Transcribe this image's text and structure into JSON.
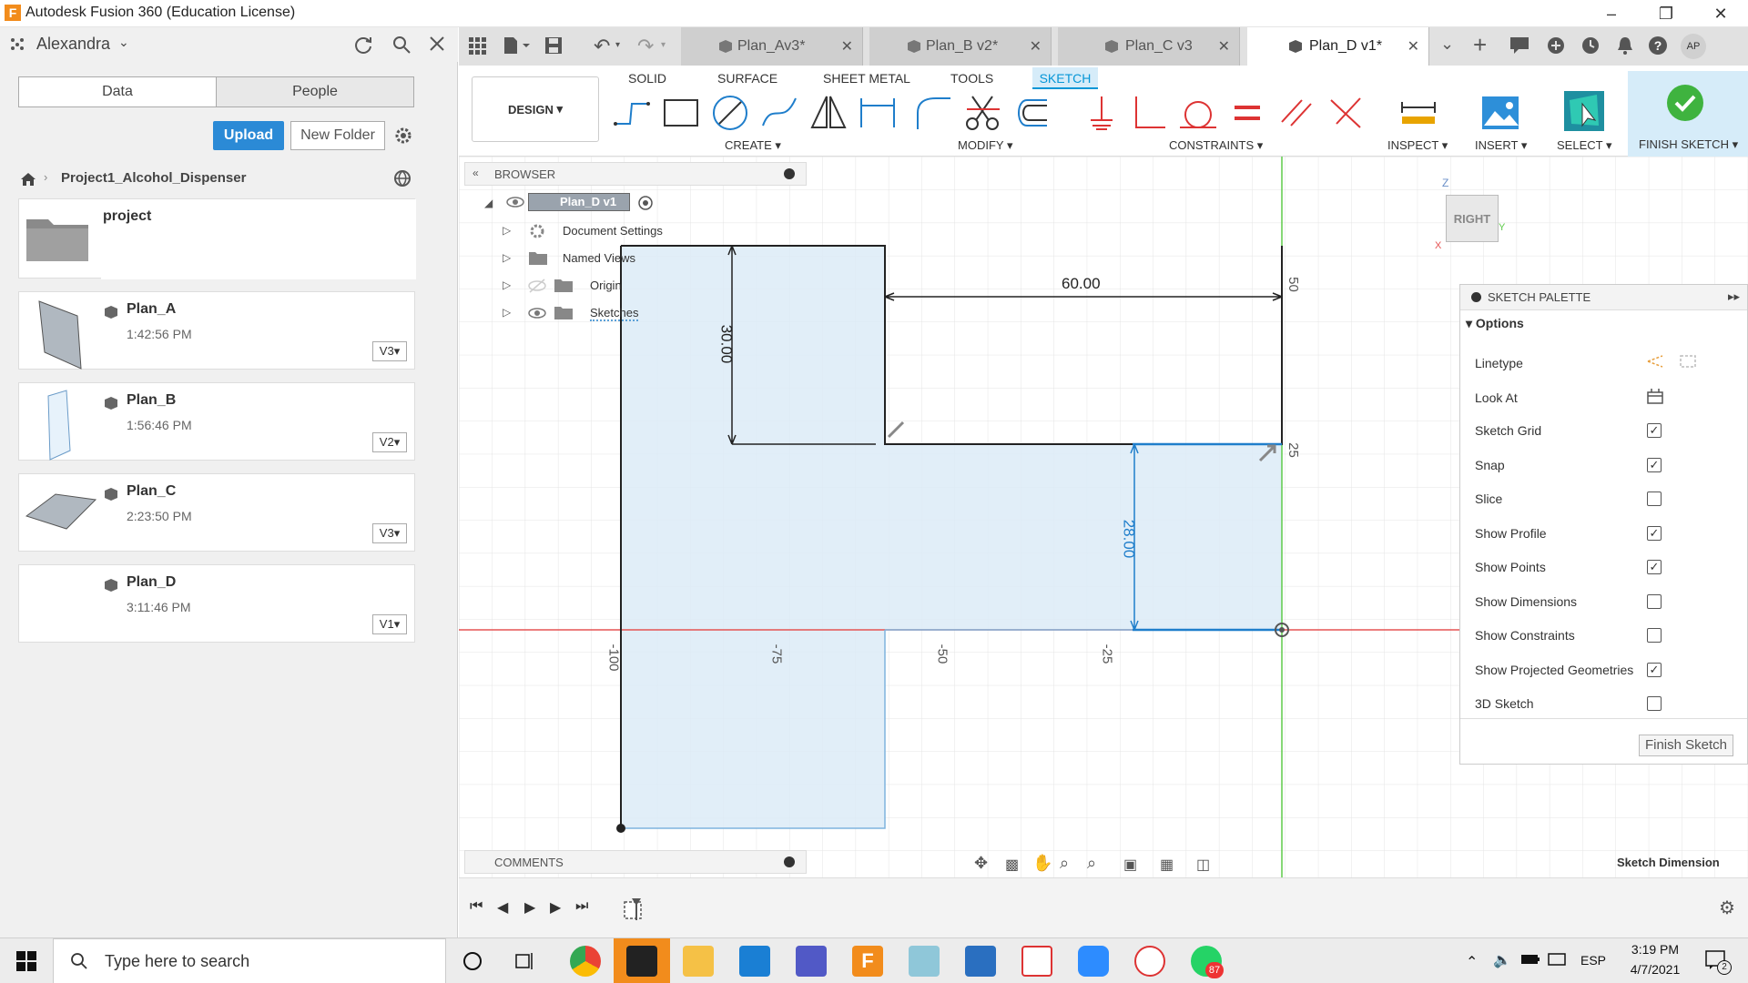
{
  "window": {
    "title": "Autodesk Fusion 360 (Education License)"
  },
  "user": {
    "name": "Alexandra",
    "initials": "AP"
  },
  "left_panel": {
    "tabs": [
      "Data",
      "People"
    ],
    "upload_label": "Upload",
    "new_folder_label": "New Folder",
    "breadcrumb": "Project1_Alcohol_Dispenser",
    "folder": {
      "name": "project"
    },
    "files": [
      {
        "name": "Plan_A",
        "time": "1:42:56 PM",
        "version": "V3"
      },
      {
        "name": "Plan_B",
        "time": "1:56:46 PM",
        "version": "V2"
      },
      {
        "name": "Plan_C",
        "time": "2:23:50 PM",
        "version": "V3"
      },
      {
        "name": "Plan_D",
        "time": "3:11:46 PM",
        "version": "V1"
      }
    ]
  },
  "doc_tabs": [
    {
      "label": "Plan_Av3*"
    },
    {
      "label": "Plan_B v2*"
    },
    {
      "label": "Plan_C v3"
    },
    {
      "label": "Plan_D v1*"
    }
  ],
  "toolbar": {
    "workspace": "DESIGN",
    "tabs": [
      "SOLID",
      "SURFACE",
      "SHEET METAL",
      "TOOLS",
      "SKETCH"
    ],
    "groups": {
      "create": "CREATE",
      "modify": "MODIFY",
      "constraints": "CONSTRAINTS",
      "inspect": "INSPECT",
      "insert": "INSERT",
      "select": "SELECT",
      "finish": "FINISH SKETCH"
    }
  },
  "browser": {
    "title": "BROWSER",
    "root": "Plan_D v1",
    "items": [
      "Document Settings",
      "Named Views",
      "Origin",
      "Sketches"
    ]
  },
  "comments": {
    "title": "COMMENTS"
  },
  "viewcube": {
    "face": "RIGHT",
    "z": "Z",
    "y": "Y",
    "x": "X"
  },
  "sketch": {
    "dims": {
      "width": "60.00",
      "left_height": "30.00",
      "right_height": "28.00"
    },
    "axis_labels_x": [
      "-100",
      "-75",
      "-50",
      "-25"
    ],
    "axis_labels_y": [
      "50",
      "25"
    ]
  },
  "palette": {
    "title": "SKETCH PALETTE",
    "section": "Options",
    "linetype": "Linetype",
    "look_at": "Look At",
    "options": [
      {
        "label": "Sketch Grid",
        "checked": true
      },
      {
        "label": "Snap",
        "checked": true
      },
      {
        "label": "Slice",
        "checked": false
      },
      {
        "label": "Show Profile",
        "checked": true
      },
      {
        "label": "Show Points",
        "checked": true
      },
      {
        "label": "Show Dimensions",
        "checked": false
      },
      {
        "label": "Show Constraints",
        "checked": false
      },
      {
        "label": "Show Projected Geometries",
        "checked": true
      },
      {
        "label": "3D Sketch",
        "checked": false
      }
    ],
    "finish_label": "Finish Sketch"
  },
  "status": {
    "hint": "Sketch Dimension"
  },
  "taskbar": {
    "search_placeholder": "Type here to search",
    "lang": "ESP",
    "time": "3:19 PM",
    "date": "4/7/2021",
    "badge": "87",
    "notif": "2"
  },
  "colors": {
    "accent": "#0696d7",
    "profile": "#dcebf7",
    "axis_red": "#e55353",
    "axis_green": "#5ecb4a"
  }
}
